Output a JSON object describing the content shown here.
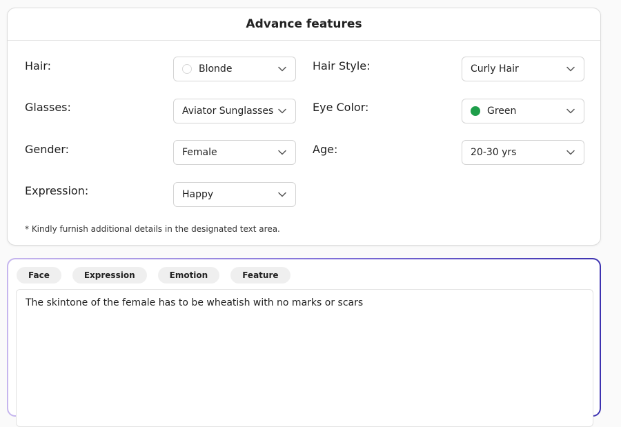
{
  "card": {
    "title": "Advance features",
    "note": "* Kindly furnish additional details in the designated text area."
  },
  "fields": {
    "hair": {
      "label": "Hair:",
      "value": "Blonde",
      "swatch": "none"
    },
    "hair_style": {
      "label": "Hair Style:",
      "value": "Curly Hair"
    },
    "glasses": {
      "label": "Glasses:",
      "value": "Aviator Sunglasses"
    },
    "eye_color": {
      "label": "Eye Color:",
      "value": "Green",
      "swatch": "#1e9e4a"
    },
    "gender": {
      "label": "Gender:",
      "value": "Female"
    },
    "age": {
      "label": "Age:",
      "value": "20-30 yrs"
    },
    "expression": {
      "label": "Expression:",
      "value": "Happy"
    }
  },
  "prompt": {
    "chips": [
      "Face",
      "Expression",
      "Emotion",
      "Feature"
    ],
    "text": "The skintone of the female has to be wheatish with no marks or scars"
  },
  "colors": {
    "border_gradient": [
      "#c6b6ee",
      "#7f6fd8",
      "#3d32b0"
    ],
    "green_swatch": "#1e9e4a"
  }
}
